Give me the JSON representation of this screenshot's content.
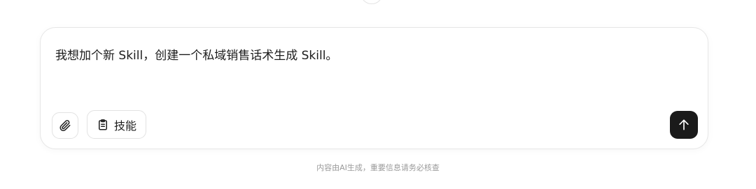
{
  "composer": {
    "input_text": "我想加个新 Skill，创建一个私域销售话术生成 Skill。",
    "attach_icon": "paperclip-icon",
    "skills_label": "技能",
    "skills_icon": "clipboard-icon",
    "send_icon": "arrow-up-icon"
  },
  "footer": {
    "disclaimer": "内容由AI生成，重要信息请务必核查"
  },
  "colors": {
    "send_button_bg": "#1a1a1a",
    "border": "#e6e6e6",
    "disclaimer_text": "#9a9a9a"
  }
}
